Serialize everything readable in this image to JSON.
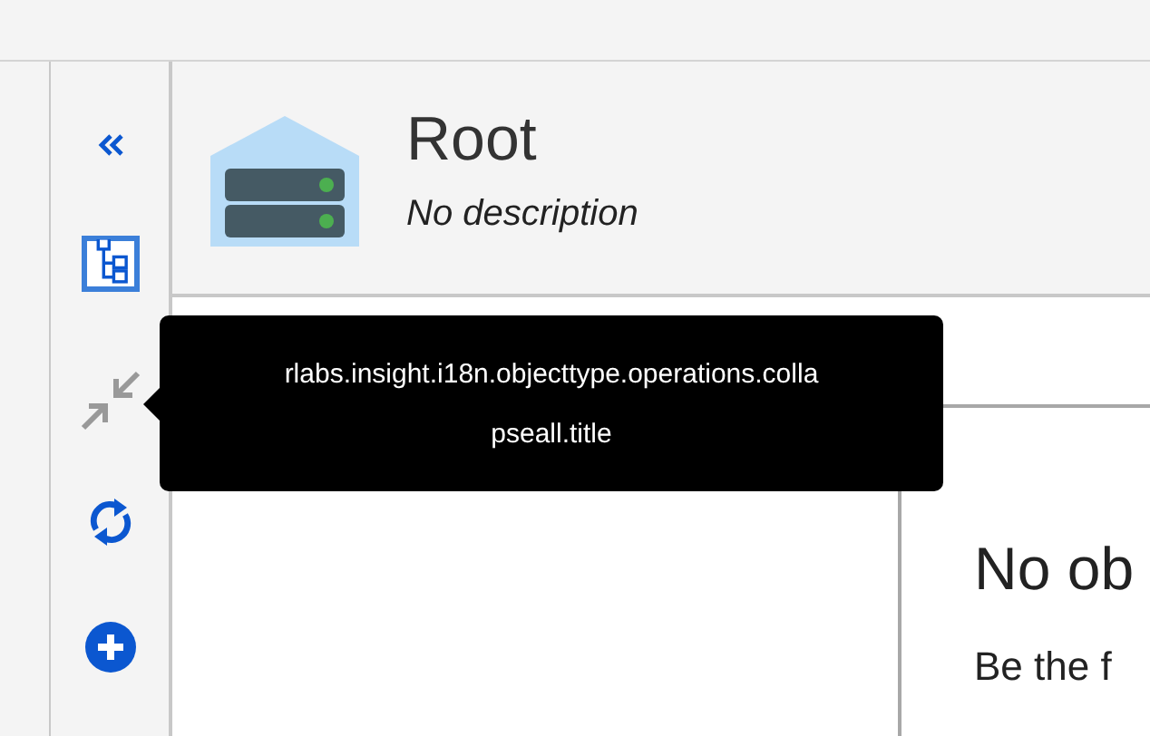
{
  "sidebar": {
    "tools": [
      {
        "kind": "collapse-panel",
        "selected": false
      },
      {
        "kind": "tree",
        "selected": true
      },
      {
        "kind": "collapse-all",
        "selected": false
      },
      {
        "kind": "refresh",
        "selected": false
      },
      {
        "kind": "add",
        "selected": false
      }
    ]
  },
  "tooltip": {
    "lines": [
      "rlabs.insight.i18n.objecttype.operations.colla",
      "pseall.title"
    ]
  },
  "header": {
    "title": "Root",
    "description": "No description"
  },
  "empty_state": {
    "title": "No ob",
    "message": "Be the f"
  }
}
